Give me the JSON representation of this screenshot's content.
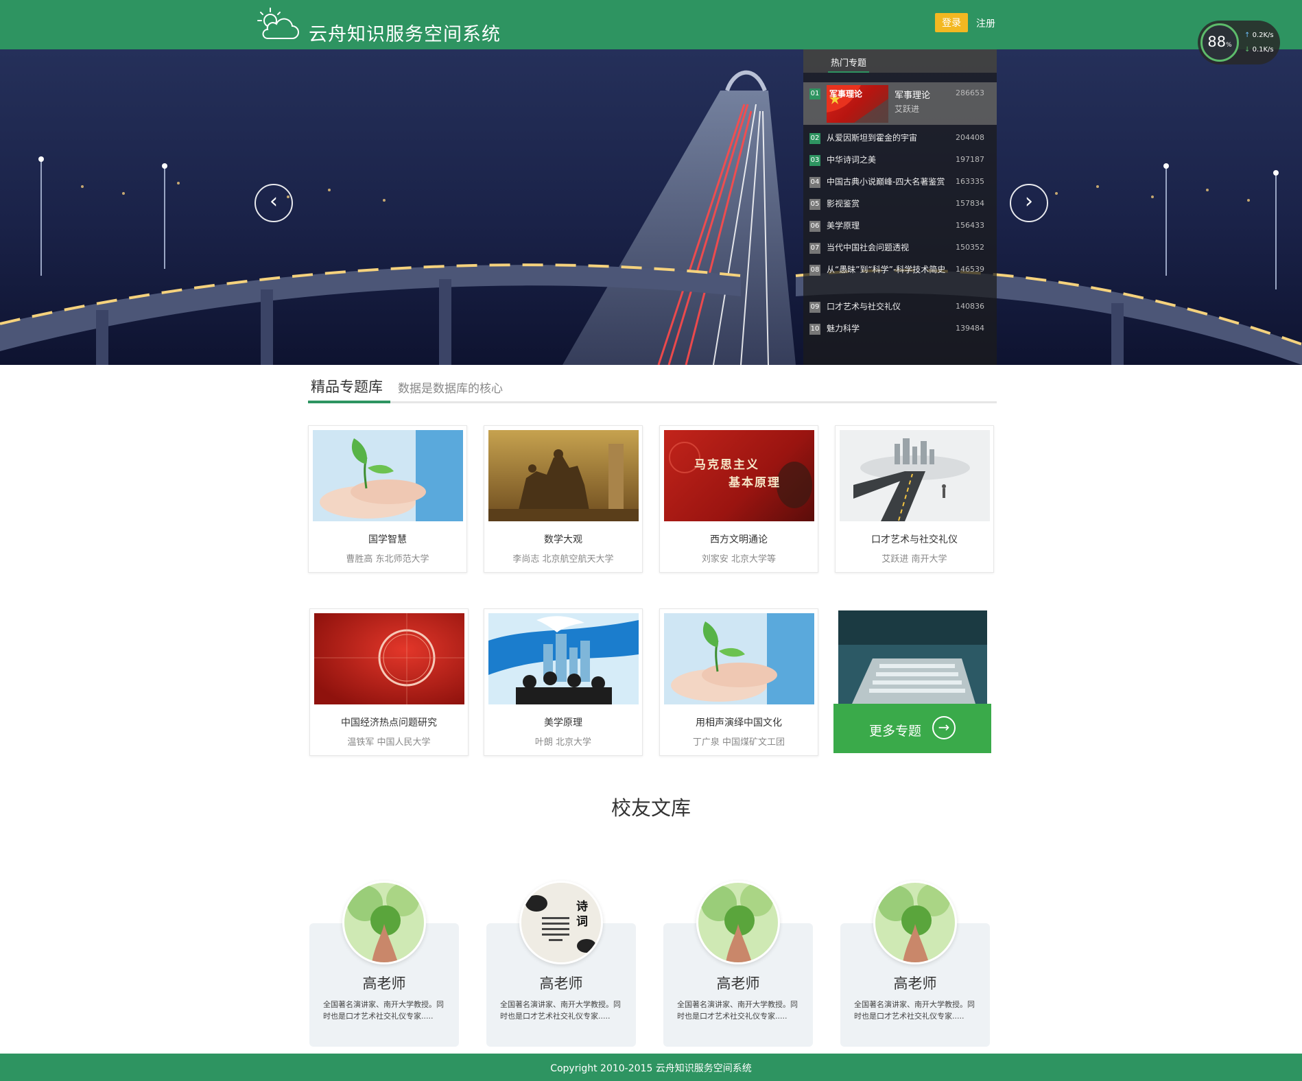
{
  "header": {
    "site_title": "云舟知识服务空间系统",
    "login_label": "登录",
    "register_label": "注册",
    "logo_icon": "cloud-sun-icon"
  },
  "speed_widget": {
    "percent": "88",
    "percent_unit": "%",
    "upload": "0.2",
    "download": "0.1",
    "unit": "K/s"
  },
  "banner": {
    "prev_icon": "chevron-left-icon",
    "next_icon": "chevron-right-icon"
  },
  "hot_topics": {
    "tab_label": "热门专题",
    "first": {
      "rank": "01",
      "thumb_label": "军事理论",
      "title": "军事理论",
      "author": "艾跃进",
      "count": "286653"
    },
    "items": [
      {
        "rank": "02",
        "title": "从爱因斯坦到霍金的宇宙",
        "count": "204408"
      },
      {
        "rank": "03",
        "title": "中华诗词之美",
        "count": "197187"
      },
      {
        "rank": "04",
        "title": "中国古典小说巅峰-四大名著鉴赏",
        "count": "163335"
      },
      {
        "rank": "05",
        "title": "影视鉴赏",
        "count": "157834"
      },
      {
        "rank": "06",
        "title": "美学原理",
        "count": "156433"
      },
      {
        "rank": "07",
        "title": "当代中国社会问题透视",
        "count": "150352"
      },
      {
        "rank": "08",
        "title": "从“愚昧”到“科学”-科学技术简史",
        "count": "146539"
      },
      {
        "rank": "09",
        "title": "口才艺术与社交礼仪",
        "count": "140836"
      },
      {
        "rank": "10",
        "title": "魅力科学",
        "count": "139484"
      }
    ]
  },
  "featured": {
    "title": "精品专题库",
    "subtitle": "数据是数据库的核心",
    "cards": [
      {
        "title": "国学智慧",
        "meta": "曹胜高  东北师范大学",
        "image": "sprout-hands"
      },
      {
        "title": "数学大观",
        "meta": "李尚志  北京航空航天大学",
        "image": "monument"
      },
      {
        "title": "西方文明通论",
        "meta": "刘家安  北京大学等",
        "image": "marxism-red",
        "image_text_1": "马克思主义",
        "image_text_2": "基本原理"
      },
      {
        "title": "口才艺术与社交礼仪",
        "meta": "艾跃进  南开大学",
        "image": "road-city"
      },
      {
        "title": "中国经济热点问题研究",
        "meta": "温铁军  中国人民大学",
        "image": "red-target"
      },
      {
        "title": "美学原理",
        "meta": "叶朗  北京大学",
        "image": "graduates-dove"
      },
      {
        "title": "用相声演绎中国文化",
        "meta": "丁广泉  中国煤矿文工团",
        "image": "sprout-hands"
      }
    ],
    "more_label": "更多专题",
    "more_icon": "arrow-right-circle-icon"
  },
  "alumni": {
    "title": "校友文库",
    "cards": [
      {
        "name": "高老师",
        "desc": "全国著名演讲家、南开大学教授。同时也是口才艺术社交礼仪专家.....",
        "avatar": "green-plant"
      },
      {
        "name": "高老师",
        "desc": "全国著名演讲家、南开大学教授。同时也是口才艺术社交礼仪专家.....",
        "avatar": "poetry-ink",
        "avatar_text": "诗词"
      },
      {
        "name": "高老师",
        "desc": "全国著名演讲家、南开大学教授。同时也是口才艺术社交礼仪专家.....",
        "avatar": "green-plant"
      },
      {
        "name": "高老师",
        "desc": "全国著名演讲家、南开大学教授。同时也是口才艺术社交礼仪专家.....",
        "avatar": "green-plant"
      }
    ]
  },
  "footer": {
    "copyright": "Copyright 2010-2015 云舟知识服务空间系统"
  },
  "colors": {
    "brand_green": "#2e9461",
    "login_yellow": "#f3b821",
    "more_green": "#3aaa4a"
  }
}
